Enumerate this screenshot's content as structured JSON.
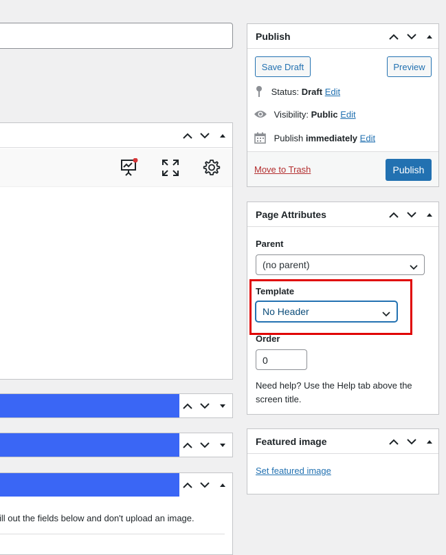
{
  "publish": {
    "title": "Publish",
    "save_draft": "Save Draft",
    "preview": "Preview",
    "status_label": "Status:",
    "status_value": "Draft",
    "visibility_label": "Visibility:",
    "visibility_value": "Public",
    "publish_label": "Publish",
    "publish_value": "immediately",
    "edit": "Edit",
    "move_to_trash": "Move to Trash",
    "publish_button": "Publish"
  },
  "page_attributes": {
    "title": "Page Attributes",
    "parent_label": "Parent",
    "parent_value": "(no parent)",
    "template_label": "Template",
    "template_value": "No Header",
    "order_label": "Order",
    "order_value": "0",
    "help_text": "Need help? Use the Help tab above the screen title."
  },
  "featured_image": {
    "title": "Featured image",
    "set_link": "Set featured image"
  },
  "main": {
    "bottom_text": "ill out the fields below and don't upload an image."
  },
  "colors": {
    "accent": "#2271b1",
    "highlight": "#e00000",
    "section_bar": "#3a66f5",
    "trash": "#b32d2e",
    "notification_dot": "#d63638"
  },
  "icons": [
    "pin-icon",
    "eye-icon",
    "calendar-icon",
    "presentation-chart-icon",
    "fullscreen-icon",
    "gear-icon",
    "chevron-up-icon",
    "chevron-down-icon",
    "triangle-toggle-icon"
  ]
}
